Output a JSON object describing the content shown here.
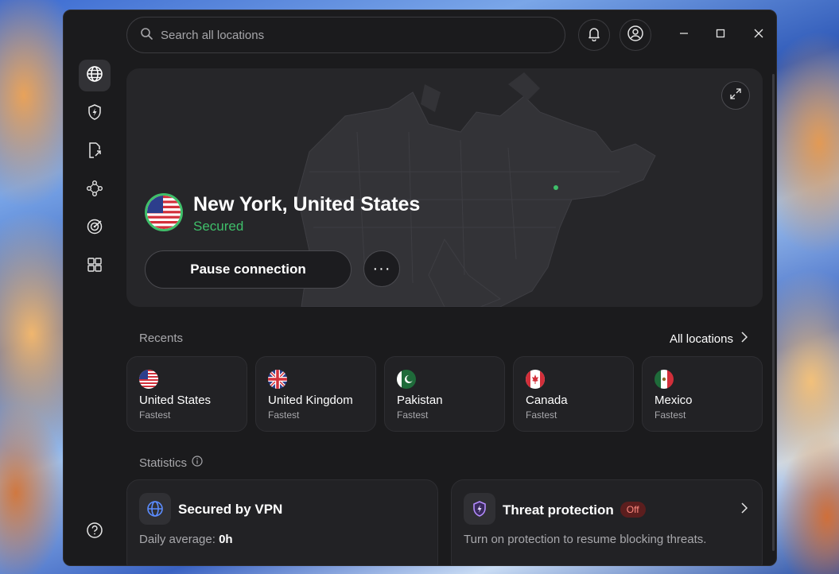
{
  "search": {
    "placeholder": "Search all locations"
  },
  "sidebar": {
    "items": [
      {
        "icon": "globe-icon"
      },
      {
        "icon": "shield-bolt-icon"
      },
      {
        "icon": "file-share-icon"
      },
      {
        "icon": "meshnet-icon"
      },
      {
        "icon": "target-icon"
      },
      {
        "icon": "apps-grid-icon"
      }
    ],
    "help_icon": "help-icon"
  },
  "hero": {
    "location": "New York, United States",
    "status": "Secured",
    "pause_label": "Pause connection",
    "more_label": "···"
  },
  "recents": {
    "label": "Recents",
    "all_locations": "All locations",
    "items": [
      {
        "name": "United States",
        "sub": "Fastest"
      },
      {
        "name": "United Kingdom",
        "sub": "Fastest"
      },
      {
        "name": "Pakistan",
        "sub": "Fastest"
      },
      {
        "name": "Canada",
        "sub": "Fastest"
      },
      {
        "name": "Mexico",
        "sub": "Fastest"
      }
    ]
  },
  "statistics": {
    "label": "Statistics",
    "vpn": {
      "title": "Secured by VPN",
      "desc_prefix": "Daily average: ",
      "desc_value": "0h"
    },
    "threat": {
      "title": "Threat protection",
      "badge": "Off",
      "desc": "Turn on protection to resume blocking threats."
    }
  },
  "colors": {
    "accent_green": "#3fbf6a",
    "background": "#1b1b1d",
    "card": "#222225"
  }
}
